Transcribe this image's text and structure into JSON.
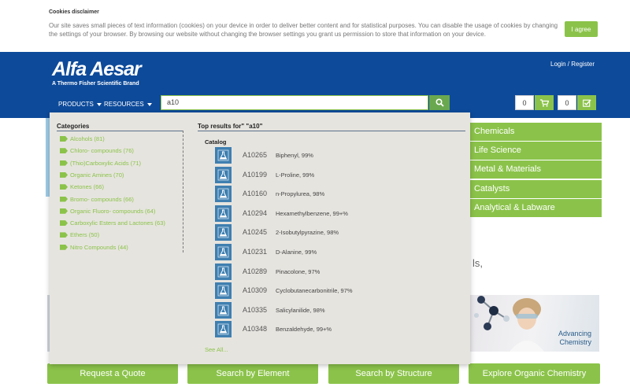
{
  "cookie": {
    "title": "Cookies disclaimer",
    "text": "Our site saves small pieces of text information (cookies) on your device in order to deliver better content and for statistical purposes. You can disable the usage of cookies by changing the settings of your browser. By browsing our website without changing the browser settings you grant us permission to store that information on your device.",
    "agree_label": "I agree"
  },
  "header": {
    "logo": "Alfa Aesar",
    "tagline": "A Thermo Fisher Scientific Brand",
    "login_label": "Login / Register",
    "nav": [
      {
        "label": "PRODUCTS"
      },
      {
        "label": "RESOURCES"
      }
    ],
    "search_value": "a10",
    "quote_count": "0",
    "cart_count": "0"
  },
  "background": {
    "categories": [
      "Chemicals",
      "Life Science",
      "Metal & Materials",
      "Catalysts",
      "Analytical & Labware"
    ],
    "partial_text": "ls,",
    "promo_text_1": "Advancing",
    "promo_text_2": "Chemistry",
    "actions": [
      "Request a Quote",
      "Search by Element",
      "Search by Structure",
      "Explore Organic Chemistry"
    ]
  },
  "dropdown": {
    "categories_title": "Categories",
    "results_title": "Top results for\" \"a10\"",
    "catalog_label": "Catalog",
    "categories": [
      {
        "label": "Alcohols (81)"
      },
      {
        "label": "Chloro- compounds (76)"
      },
      {
        "label": "(Thio)Carboxylic Acids (71)"
      },
      {
        "label": "Organic Amines (70)"
      },
      {
        "label": "Ketones (66)"
      },
      {
        "label": "Bromo- compounds (66)"
      },
      {
        "label": "Organic Fluoro- compounds (64)"
      },
      {
        "label": "Carboxylic Esters and Lactones (63)"
      },
      {
        "label": "Ethers (50)"
      },
      {
        "label": "Nitro Compounds (44)"
      }
    ],
    "results": [
      {
        "id": "A10265",
        "name": "Biphenyl, 99%"
      },
      {
        "id": "A10199",
        "name": "L-Proline, 99%"
      },
      {
        "id": "A10160",
        "name": "n-Propylurea, 98%"
      },
      {
        "id": "A10294",
        "name": "Hexamethylbenzene, 99+%"
      },
      {
        "id": "A10245",
        "name": "2-Isobutylpyrazine, 98%"
      },
      {
        "id": "A10231",
        "name": "D-Alanine, 99%"
      },
      {
        "id": "A10289",
        "name": "Pinacolone, 97%"
      },
      {
        "id": "A10309",
        "name": "Cyclobutanecarbonitrile, 97%"
      },
      {
        "id": "A10335",
        "name": "Salicylanilide, 98%"
      },
      {
        "id": "A10348",
        "name": "Benzaldehyde, 99+%"
      }
    ],
    "see_all_label": "See All..."
  }
}
